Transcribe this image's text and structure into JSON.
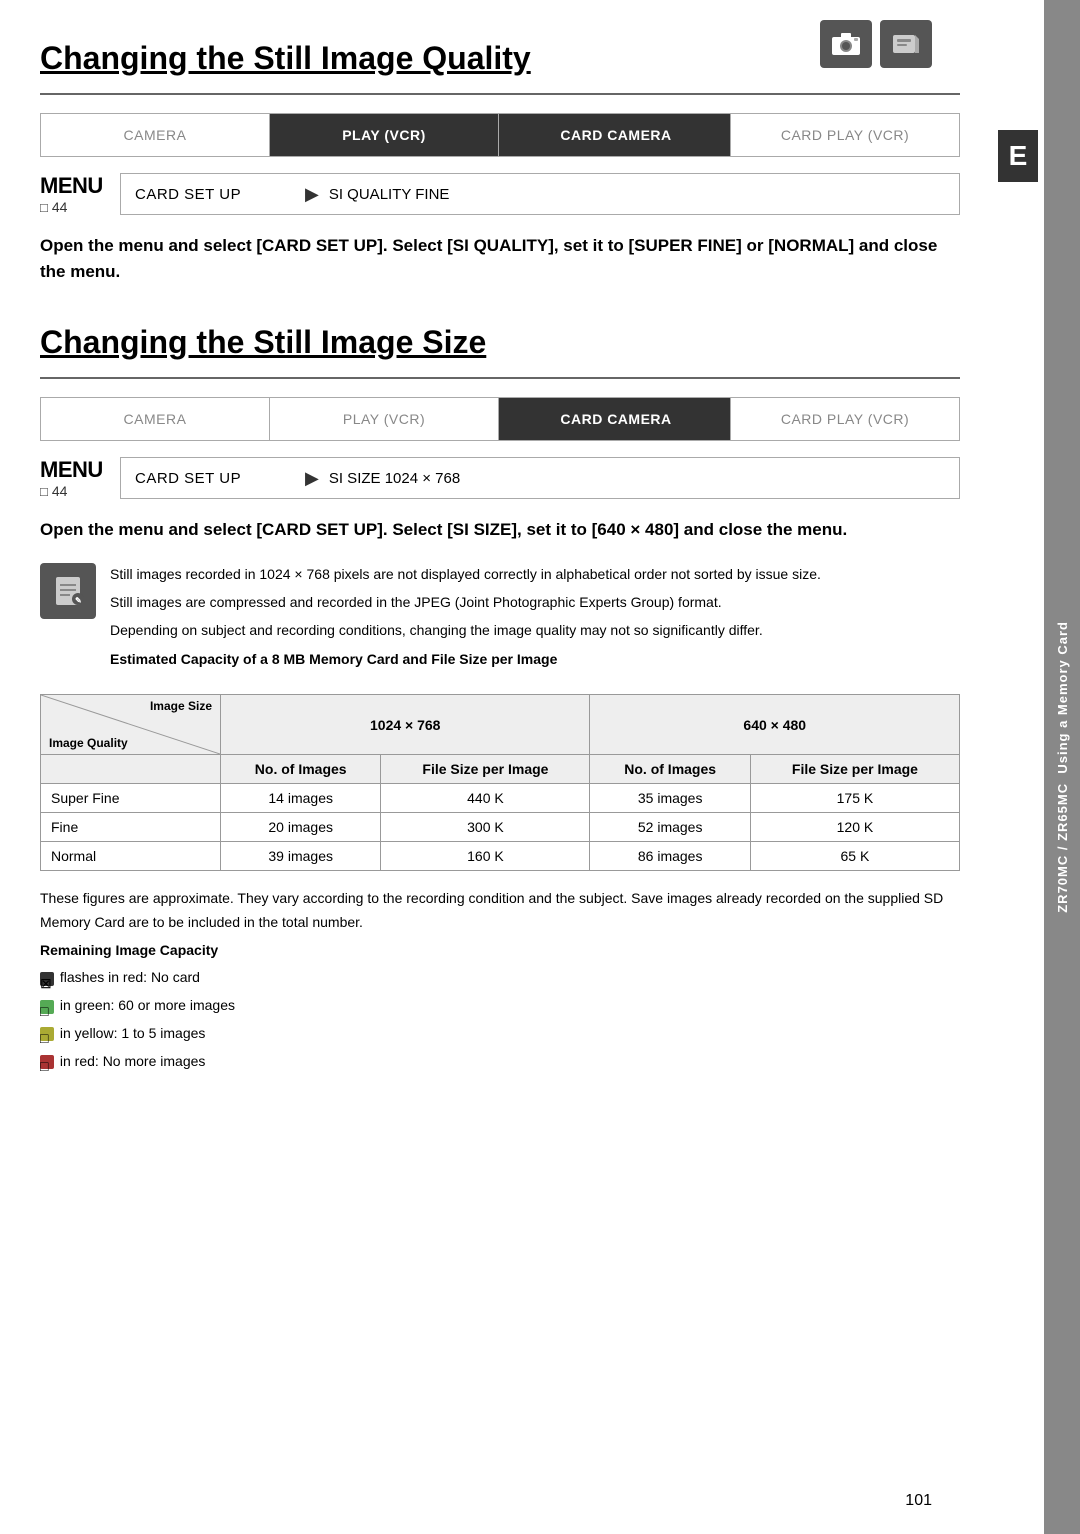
{
  "top_icons": {
    "icon1_label": "camera-icon",
    "icon2_label": "card-icon"
  },
  "section1": {
    "title": "Changing the Still Image Quality",
    "tabs": [
      {
        "label": "CAMERA",
        "active": false
      },
      {
        "label": "PLAY (VCR)",
        "active": true
      },
      {
        "label": "CARD CAMERA",
        "active": true
      },
      {
        "label": "CARD PLAY (VCR)",
        "active": false
      }
    ],
    "menu_label": "MENU",
    "menu_page": "44",
    "menu_item": "CARD SET UP",
    "menu_arrow": "▶",
    "menu_value": "SI QUALITY  FINE",
    "body_text": "Open the menu and select [CARD SET UP]. Select [SI QUALITY], set it to [SUPER FINE] or [NORMAL] and close the menu."
  },
  "section2": {
    "title": "Changing the Still Image Size",
    "tabs": [
      {
        "label": "CAMERA",
        "active": false
      },
      {
        "label": "PLAY (VCR)",
        "active": false
      },
      {
        "label": "CARD CAMERA",
        "active": true
      },
      {
        "label": "CARD PLAY (VCR)",
        "active": false
      }
    ],
    "menu_label": "MENU",
    "menu_page": "44",
    "menu_item": "CARD SET UP",
    "menu_arrow": "▶",
    "menu_value": "SI SIZE        1024 × 768",
    "body_text": "Open the menu and select [CARD SET UP]. Select [SI SIZE], set it to [640 × 480] and close the menu."
  },
  "note": {
    "line1": "Still images recorded in 1024 × 768 pixels are not displayed correctly in alphabetical order not sorted by issue size.",
    "line2": "Still images are compressed and recorded in the JPEG (Joint Photographic Experts Group) format.",
    "line3": "Depending on subject and recording conditions, changing the image quality may not so significantly differ.",
    "line4": "Estimated Capacity of a 8 MB Memory Card and File Size per Image"
  },
  "table": {
    "diag_top": "Image Size",
    "diag_bottom": "Image Quality",
    "col_headers": [
      "1024 × 768",
      "",
      "640 × 480",
      ""
    ],
    "sub_headers": [
      "No. of Images",
      "File Size per Image",
      "No. of Images",
      "File Size per Image"
    ],
    "rows": [
      {
        "quality": "Super Fine",
        "n1024": "14 images",
        "f1024": "440 K",
        "n640": "35 images",
        "f640": "175 K"
      },
      {
        "quality": "Fine",
        "n1024": "20 images",
        "f1024": "300 K",
        "n640": "52 images",
        "f640": "120 K"
      },
      {
        "quality": "Normal",
        "n1024": "39 images",
        "f1024": "160 K",
        "n640": "86 images",
        "f640": "65 K"
      }
    ]
  },
  "bottom": {
    "para1": "These figures are approximate. They vary according to the recording condition and the subject. Save images already recorded on the supplied SD Memory Card are to be included in the total number.",
    "remaining_label": "Remaining Image Capacity",
    "line_flash": "flashes in red: No card",
    "line_green": "in green: 60 or more images",
    "line_yellow": "in yellow: 1 to 5 images",
    "line_red": "in red: No more images"
  },
  "sidebar_e": "E",
  "sidebar_right": "Using a Memory Card",
  "page_number": "101",
  "brand_labels": [
    "ZR70MC",
    "ZR65MC"
  ]
}
